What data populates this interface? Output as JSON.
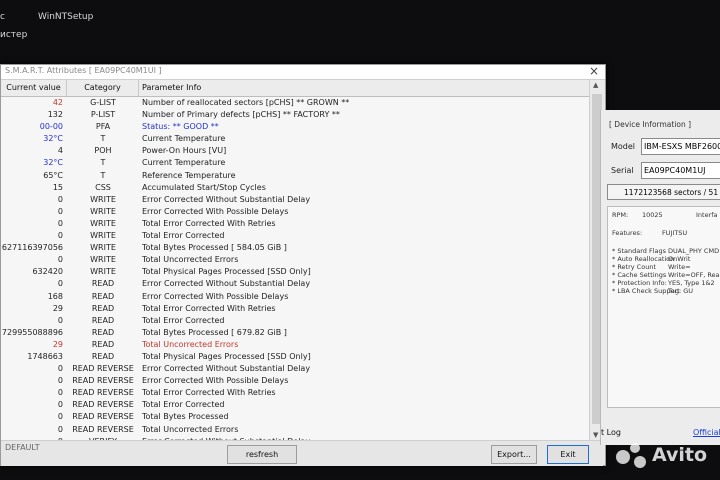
{
  "desktop": {
    "icon1_label": "с",
    "icon2_label": "WinNTSetup",
    "icon3_label": "истер"
  },
  "window": {
    "title": "S.M.A.R.T. Attributes [ EA09PC40M1UI ]",
    "close_icon": "×"
  },
  "columns": {
    "value": "Current value",
    "category": "Category",
    "info": "Parameter Info"
  },
  "rows": [
    {
      "value": "42",
      "category": "G-LIST",
      "info": "Number of reallocated sectors [pCHS]  ** GROWN **",
      "value_color": "#c0392b",
      "info_color": "#222222"
    },
    {
      "value": "132",
      "category": "P-LIST",
      "info": "Number of Primary defects [pCHS]  ** FACTORY **",
      "value_color": "#222222",
      "info_color": "#222222"
    },
    {
      "value": "00-00",
      "category": "PFA",
      "info": "Status: ** GOOD **",
      "value_color": "#2233cc",
      "info_color": "#2233cc"
    },
    {
      "value": "32°C",
      "category": "T",
      "info": "Current Temperature",
      "value_color": "#2233cc",
      "info_color": "#222222"
    },
    {
      "value": "4",
      "category": "POH",
      "info": "Power-On Hours [VU]",
      "value_color": "#222222",
      "info_color": "#222222"
    },
    {
      "value": "32°C",
      "category": "T",
      "info": "Current Temperature",
      "value_color": "#2233cc",
      "info_color": "#222222"
    },
    {
      "value": "65°C",
      "category": "T",
      "info": "Reference Temperature",
      "value_color": "#222222",
      "info_color": "#222222"
    },
    {
      "value": "15",
      "category": "CSS",
      "info": "Accumulated Start/Stop Cycles",
      "value_color": "#222222",
      "info_color": "#222222"
    },
    {
      "value": "0",
      "category": "WRITE",
      "info": "Error Corrected Without Substantial Delay",
      "value_color": "#222222",
      "info_color": "#222222"
    },
    {
      "value": "0",
      "category": "WRITE",
      "info": "Error Corrected With Possible Delays",
      "value_color": "#222222",
      "info_color": "#222222"
    },
    {
      "value": "0",
      "category": "WRITE",
      "info": "Total Error Corrected With Retries",
      "value_color": "#222222",
      "info_color": "#222222"
    },
    {
      "value": "0",
      "category": "WRITE",
      "info": "Total Error Corrected",
      "value_color": "#222222",
      "info_color": "#222222"
    },
    {
      "value": "627116397056",
      "category": "WRITE",
      "info": "Total Bytes Processed [ 584.05 GiB ]",
      "value_color": "#222222",
      "info_color": "#222222"
    },
    {
      "value": "0",
      "category": "WRITE",
      "info": "Total Uncorrected Errors",
      "value_color": "#222222",
      "info_color": "#222222"
    },
    {
      "value": "632420",
      "category": "WRITE",
      "info": "Total Physical Pages Processed [SSD Only]",
      "value_color": "#222222",
      "info_color": "#222222"
    },
    {
      "value": "0",
      "category": "READ",
      "info": "Error Corrected Without Substantial Delay",
      "value_color": "#222222",
      "info_color": "#222222"
    },
    {
      "value": "168",
      "category": "READ",
      "info": "Error Corrected With Possible Delays",
      "value_color": "#222222",
      "info_color": "#222222"
    },
    {
      "value": "29",
      "category": "READ",
      "info": "Total Error Corrected With Retries",
      "value_color": "#222222",
      "info_color": "#222222"
    },
    {
      "value": "0",
      "category": "READ",
      "info": "Total Error Corrected",
      "value_color": "#222222",
      "info_color": "#222222"
    },
    {
      "value": "729955088896",
      "category": "READ",
      "info": "Total Bytes Processed [ 679.82 GiB ]",
      "value_color": "#222222",
      "info_color": "#222222"
    },
    {
      "value": "29",
      "category": "READ",
      "info": "Total Uncorrected Errors",
      "value_color": "#c0392b",
      "info_color": "#c0392b"
    },
    {
      "value": "1748663",
      "category": "READ",
      "info": "Total Physical Pages Processed [SSD Only]",
      "value_color": "#222222",
      "info_color": "#222222"
    },
    {
      "value": "0",
      "category": "READ REVERSE",
      "info": "Error Corrected Without Substantial Delay",
      "value_color": "#222222",
      "info_color": "#222222"
    },
    {
      "value": "0",
      "category": "READ REVERSE",
      "info": "Error Corrected With Possible Delays",
      "value_color": "#222222",
      "info_color": "#222222"
    },
    {
      "value": "0",
      "category": "READ REVERSE",
      "info": "Total Error Corrected With Retries",
      "value_color": "#222222",
      "info_color": "#222222"
    },
    {
      "value": "0",
      "category": "READ REVERSE",
      "info": "Total Error Corrected",
      "value_color": "#222222",
      "info_color": "#222222"
    },
    {
      "value": "0",
      "category": "READ REVERSE",
      "info": "Total Bytes Processed",
      "value_color": "#222222",
      "info_color": "#222222"
    },
    {
      "value": "0",
      "category": "READ REVERSE",
      "info": "Total Uncorrected Errors",
      "value_color": "#222222",
      "info_color": "#222222"
    },
    {
      "value": "0",
      "category": "VERIFY",
      "info": "Error Corrected Without Substantial Delay",
      "value_color": "#222222",
      "info_color": "#222222"
    }
  ],
  "scroll": {
    "up_icon": "▲",
    "down_icon": "▼"
  },
  "bottom": {
    "default_label": "DEFAULT",
    "refresh_label": "resfresh",
    "export_label": "Export...",
    "exit_label": "Exit"
  },
  "device_panel": {
    "title": "[ Device Information ]",
    "model_label": "Model",
    "model_value": "IBM-ESXS MBF2600",
    "serial_label": "Serial",
    "serial_value": "EA09PC40M1UJ",
    "sectors_text": "1172123568 sectors / 51",
    "rpm_label": "RPM:",
    "rpm_value": "10025",
    "interface_label": "Interfa",
    "features_label": "Features:",
    "features_value": "FUJITSU",
    "flags": [
      {
        "label": "* Standard Flags",
        "value": "DUAL_PHY CMD"
      },
      {
        "label": "* Auto Reallocation",
        "value": "OnWrit"
      },
      {
        "label": "* Retry Count",
        "value": "Write="
      },
      {
        "label": "* Cache Settings",
        "value": "Write=OFF, Rea"
      },
      {
        "label": "* Protection Info:",
        "value": "YES, Type 1&2"
      },
      {
        "label": "* LBA Check Support",
        "value": "Tag: GU"
      }
    ],
    "log_label": "t Log",
    "official_label": "Official"
  },
  "watermark": {
    "text": "Avito"
  }
}
